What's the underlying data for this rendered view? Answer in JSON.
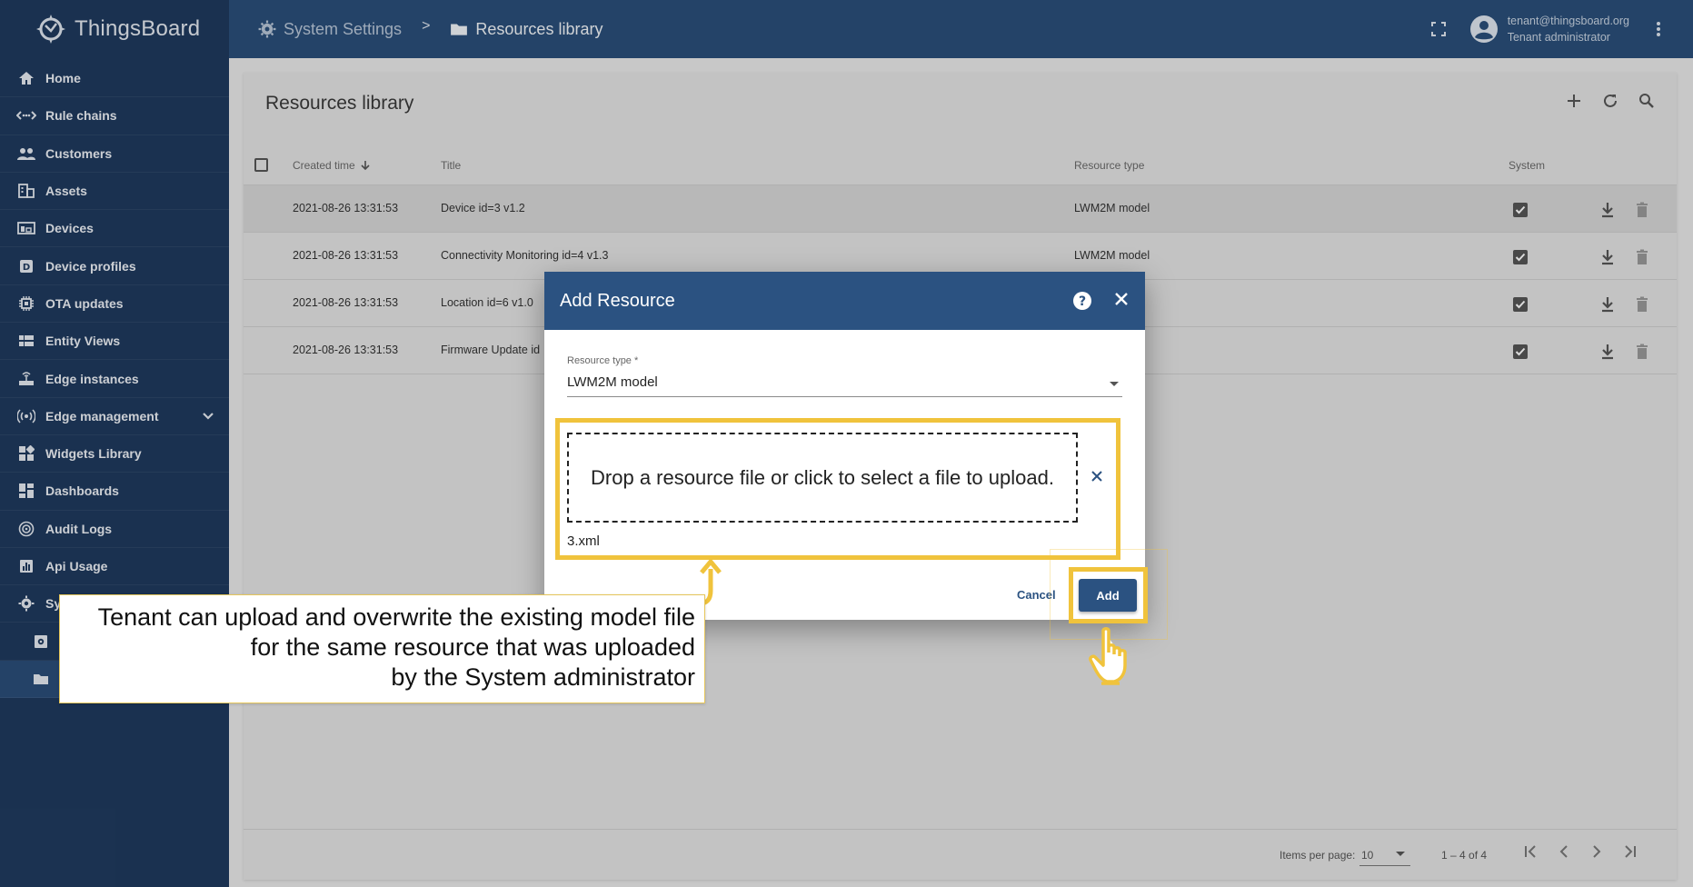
{
  "app": {
    "name": "ThingsBoard"
  },
  "sidebar": {
    "items": [
      {
        "label": "Home",
        "icon": "home-icon"
      },
      {
        "label": "Rule chains",
        "icon": "rule-chains-icon"
      },
      {
        "label": "Customers",
        "icon": "customers-icon"
      },
      {
        "label": "Assets",
        "icon": "assets-icon"
      },
      {
        "label": "Devices",
        "icon": "devices-icon"
      },
      {
        "label": "Device profiles",
        "icon": "device-profiles-icon"
      },
      {
        "label": "OTA updates",
        "icon": "ota-updates-icon"
      },
      {
        "label": "Entity Views",
        "icon": "entity-views-icon"
      },
      {
        "label": "Edge instances",
        "icon": "edge-instances-icon"
      },
      {
        "label": "Edge management",
        "icon": "edge-management-icon"
      },
      {
        "label": "Widgets Library",
        "icon": "widgets-library-icon"
      },
      {
        "label": "Dashboards",
        "icon": "dashboards-icon"
      },
      {
        "label": "Audit Logs",
        "icon": "audit-logs-icon"
      },
      {
        "label": "Api Usage",
        "icon": "api-usage-icon"
      },
      {
        "label": "Sy",
        "icon": "gear-icon"
      }
    ]
  },
  "header": {
    "breadcrumb": [
      "System Settings",
      ">",
      "Resources library"
    ],
    "user": {
      "email": "tenant@thingsboard.org",
      "role": "Tenant administrator"
    }
  },
  "card": {
    "title": "Resources library",
    "columns": {
      "created": "Created time",
      "title": "Title",
      "type": "Resource type",
      "system": "System"
    },
    "rows": [
      {
        "created": "2021-08-26 13:31:53",
        "title": "Device id=3 v1.2",
        "type": "LWM2M model"
      },
      {
        "created": "2021-08-26 13:31:53",
        "title": "Connectivity Monitoring id=4 v1.3",
        "type": "LWM2M model"
      },
      {
        "created": "2021-08-26 13:31:53",
        "title": "Location id=6 v1.0",
        "type": "el"
      },
      {
        "created": "2021-08-26 13:31:53",
        "title": "Firmware Update id",
        "type": "el"
      }
    ],
    "paginator": {
      "label": "Items per page:",
      "size": "10",
      "range": "1 – 4 of 4"
    }
  },
  "dialog": {
    "title": "Add Resource",
    "resource_type_label": "Resource type *",
    "resource_type_value": "LWM2M model",
    "dropzone_text": "Drop a resource file or click to select a file to upload.",
    "file_name": "3.xml",
    "cancel_label": "Cancel",
    "add_label": "Add"
  },
  "callout": {
    "line1": "Tenant can upload and overwrite the existing model file",
    "line2": "for the same resource that was uploaded",
    "line3": "by the System administrator"
  },
  "colors": {
    "sidebar": "#1f3a5e",
    "header": "#2a4f7a",
    "dialog_header": "#2b5281",
    "highlight": "#f0c33c"
  }
}
